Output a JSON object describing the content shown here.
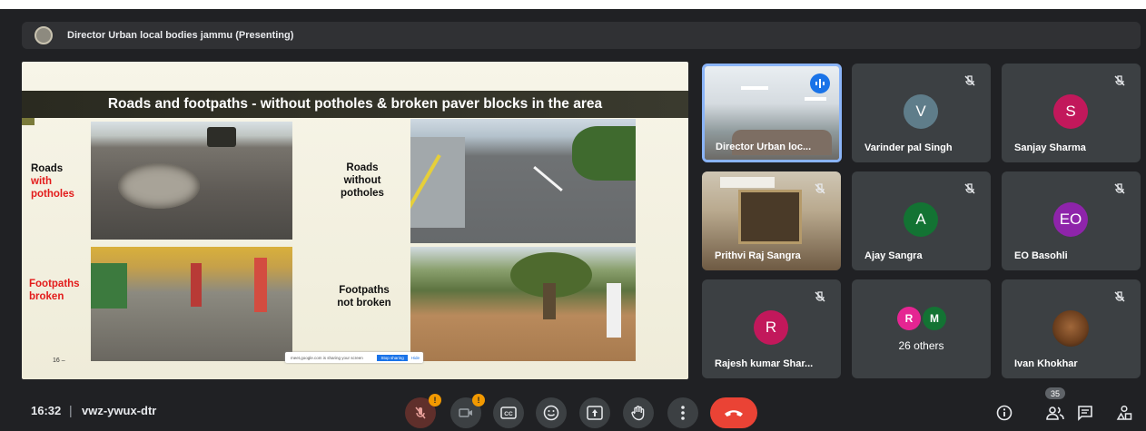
{
  "presenting": {
    "label": "Director Urban local bodies jammu (Presenting)"
  },
  "slide": {
    "title": "Roads and footpaths - without potholes & broken paver blocks in the area",
    "label_roads": "Roads",
    "label_with": "with",
    "label_potholes": "potholes",
    "label_roads_without": "Roads",
    "label_without": "without",
    "label_potholes2": "potholes",
    "label_footpaths": "Footpaths",
    "label_broken": "broken",
    "label_footpaths2": "Footpaths",
    "label_not_broken": "not broken",
    "page_number": "16 –",
    "share_text": "meet.google.com is sharing your screen",
    "share_stop": "Stop sharing",
    "share_hide": "Hide"
  },
  "participants": [
    {
      "name": "Director Urban loc...",
      "initial": "",
      "color": ""
    },
    {
      "name": "Varinder pal Singh",
      "initial": "V",
      "color": "#5f7d8a"
    },
    {
      "name": "Sanjay Sharma",
      "initial": "S",
      "color": "#c2185b"
    },
    {
      "name": "Prithvi Raj Sangra",
      "initial": "",
      "color": ""
    },
    {
      "name": "Ajay Sangra",
      "initial": "A",
      "color": "#137333"
    },
    {
      "name": "EO Basohli",
      "initial": "EO",
      "color": "#8e24aa"
    },
    {
      "name": "Rajesh kumar Shar...",
      "initial": "R",
      "color": "#c2185b"
    },
    {
      "name": "Ivan Khokhar",
      "initial": "",
      "color": ""
    }
  ],
  "others": {
    "avatar1": "R",
    "avatar2": "M",
    "label": "26 others"
  },
  "meeting": {
    "time": "16:32",
    "separator": "|",
    "code": "vwz-ywux-dtr"
  },
  "controls": {
    "mic_badge": "!",
    "cam_badge": "!",
    "people_count": "35"
  }
}
